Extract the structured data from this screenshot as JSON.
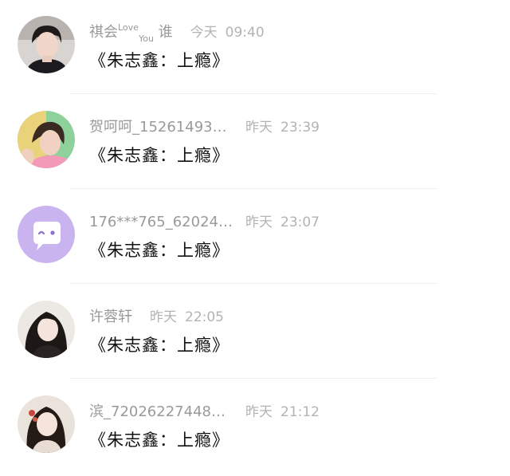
{
  "comments": [
    {
      "name_main": "祺会",
      "name_sup": "Love",
      "name_sub": "You",
      "name_tail": " 谁",
      "day": "今天",
      "time": "09:40",
      "message": "《朱志鑫：上瘾》"
    },
    {
      "name": "贺呵呵_15261493…",
      "day": "昨天",
      "time": "23:39",
      "message": "《朱志鑫：上瘾》"
    },
    {
      "name": "176***765_62024…",
      "day": "昨天",
      "time": "23:07",
      "message": "《朱志鑫：上瘾》"
    },
    {
      "name": "许蓉轩",
      "day": "昨天",
      "time": "22:05",
      "message": "《朱志鑫：上瘾》"
    },
    {
      "name": "滨_72026227448…",
      "day": "昨天",
      "time": "21:12",
      "message": "《朱志鑫：上瘾》"
    }
  ],
  "colors": {
    "default_avatar_bg": "#c9b4f0",
    "name_text": "#9a9a9a",
    "message_text": "#111111"
  }
}
